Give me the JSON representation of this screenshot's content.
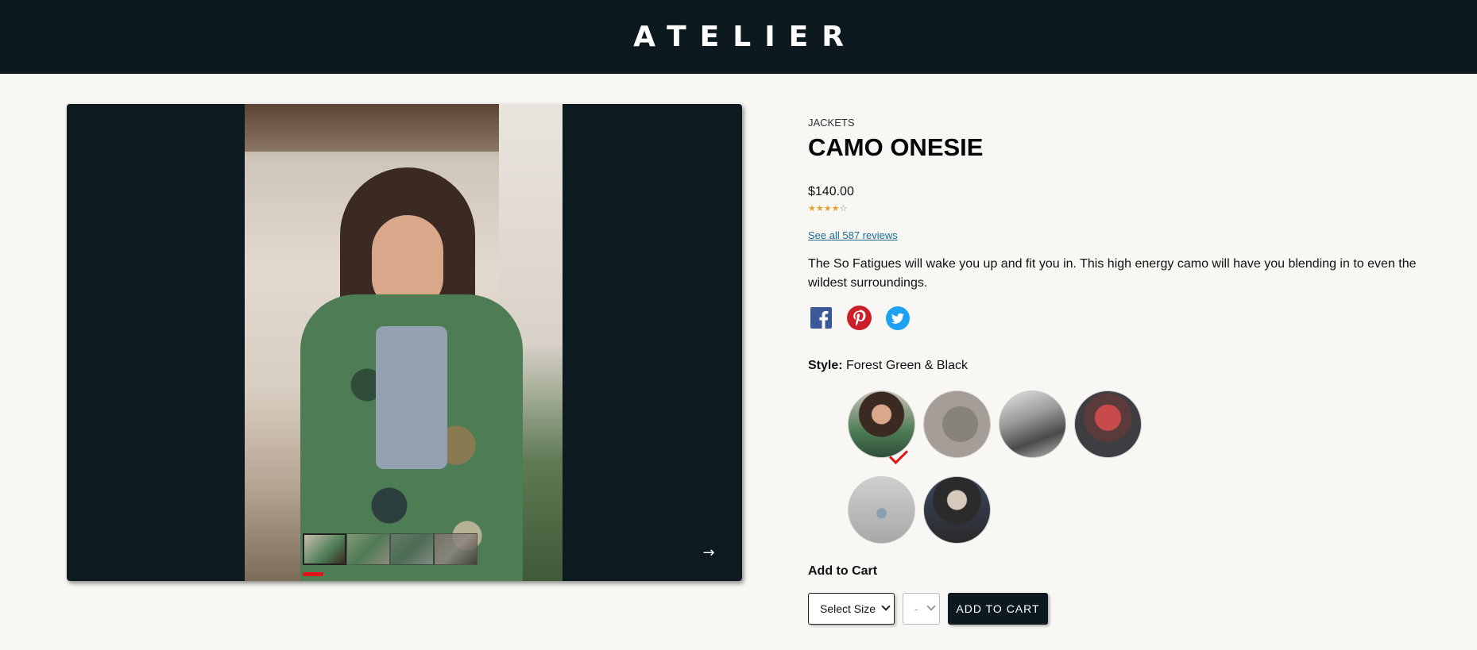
{
  "header": {
    "logo": "ATELIER"
  },
  "gallery": {
    "main_image": "woman-in-camo-jacket-photo",
    "thumbnails": [
      "camo-jacket-front",
      "camo-jacket-alt",
      "camo-jacket-detail",
      "camo-jacket-back"
    ],
    "selected_thumbnail": 0,
    "next_icon": "arrow-right-icon",
    "next_glyph": "→"
  },
  "product": {
    "category": "JACKETS",
    "title": "CAMO ONESIE",
    "price": "$140.00",
    "rating": 4,
    "rating_max": 5,
    "stars_filled": "★★★★",
    "stars_empty": "☆",
    "reviews_link": "See all 587 reviews",
    "description": "The So Fatigues will wake you up and fit you in. This high energy camo will have you blending in to even the wildest surroundings."
  },
  "social": [
    "facebook-icon",
    "pinterest-icon",
    "twitter-icon"
  ],
  "style": {
    "label": "Style:",
    "value": "Forest Green & Black",
    "swatches": [
      "forest-green-black",
      "stone",
      "grey-industrial",
      "red-night",
      "fog",
      "urban-dark"
    ],
    "selected_index": 0
  },
  "cart": {
    "label": "Add to Cart",
    "size_select": "Select Size",
    "qty_select": "-",
    "button": "ADD TO CART"
  },
  "colors": {
    "header_bg": "#0c1a20",
    "page_bg": "#f9f7f3",
    "accent_red": "#e21414",
    "link": "#1a6a93",
    "star": "#e3a12a"
  }
}
